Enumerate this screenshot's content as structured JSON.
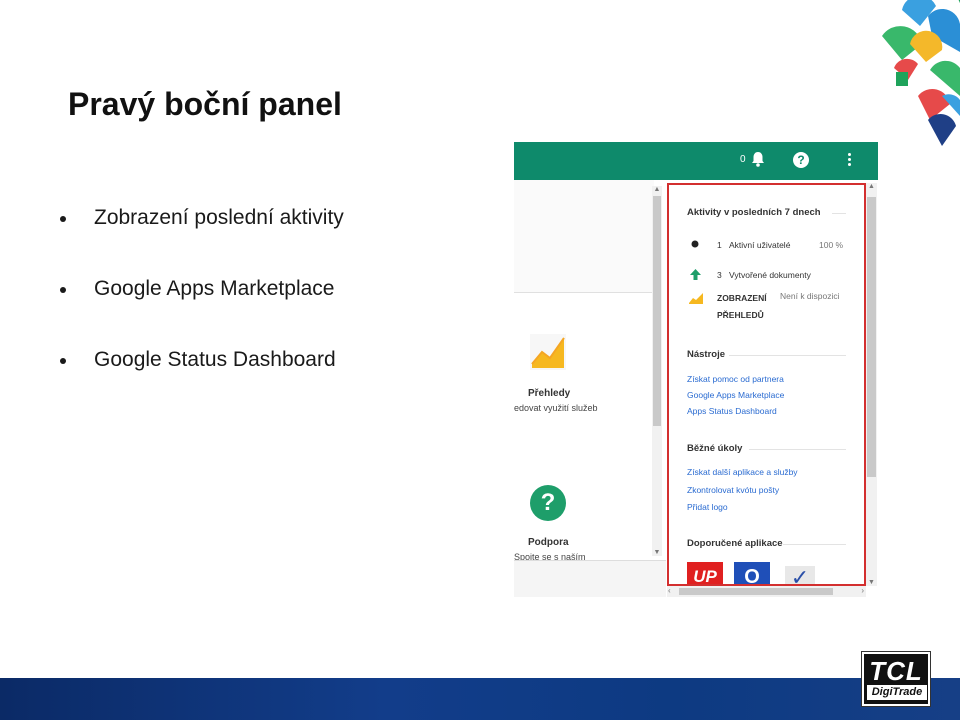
{
  "slide": {
    "title": "Pravý boční panel",
    "bullets": [
      "Zobrazení poslední aktivity",
      "Google Apps Marketplace",
      "Google Status Dashboard"
    ]
  },
  "logo": {
    "line1": "TCL",
    "line2": "DigiTrade"
  },
  "screenshot": {
    "topbar": {
      "notification_count": "0",
      "help_glyph": "?",
      "accent": "#0e8a6b"
    },
    "left_pane": {
      "reports": {
        "label": "Přehledy",
        "description": "edovat využití služeb"
      },
      "support": {
        "label": "Podpora",
        "description": "Spojte se s naším"
      }
    },
    "panel": {
      "activity_title": "Aktivity v posledních 7 dnech",
      "activity_rows": [
        {
          "icon": "circle-icon",
          "count": "1",
          "label": "Aktivní uživatelé",
          "value": "100 %"
        },
        {
          "icon": "arrow-up-icon",
          "count": "3",
          "label": "Vytvořené dokumenty",
          "value": ""
        }
      ],
      "reports_row": {
        "label_line1": "ZOBRAZENÍ",
        "label_line2": "PŘEHLEDŮ",
        "status": "Není k dispozici"
      },
      "tools_title": "Nástroje",
      "tools_links": [
        "Získat pomoc od partnera",
        "Google Apps Marketplace",
        "Apps Status Dashboard"
      ],
      "tasks_title": "Běžné úkoly",
      "tasks_links": [
        "Získat další aplikace a služby",
        "Zkontrolovat kvótu pošty",
        "Přidat logo"
      ],
      "apps_title": "Doporučené aplikace",
      "apps": [
        {
          "name": "up-app-icon",
          "text": "UP",
          "color": "#e02020"
        },
        {
          "name": "o-app-icon",
          "text": "O",
          "color": "#1f4fb8"
        },
        {
          "name": "check-app-icon",
          "text": "✓",
          "color": "#2a4fa8"
        }
      ]
    }
  }
}
